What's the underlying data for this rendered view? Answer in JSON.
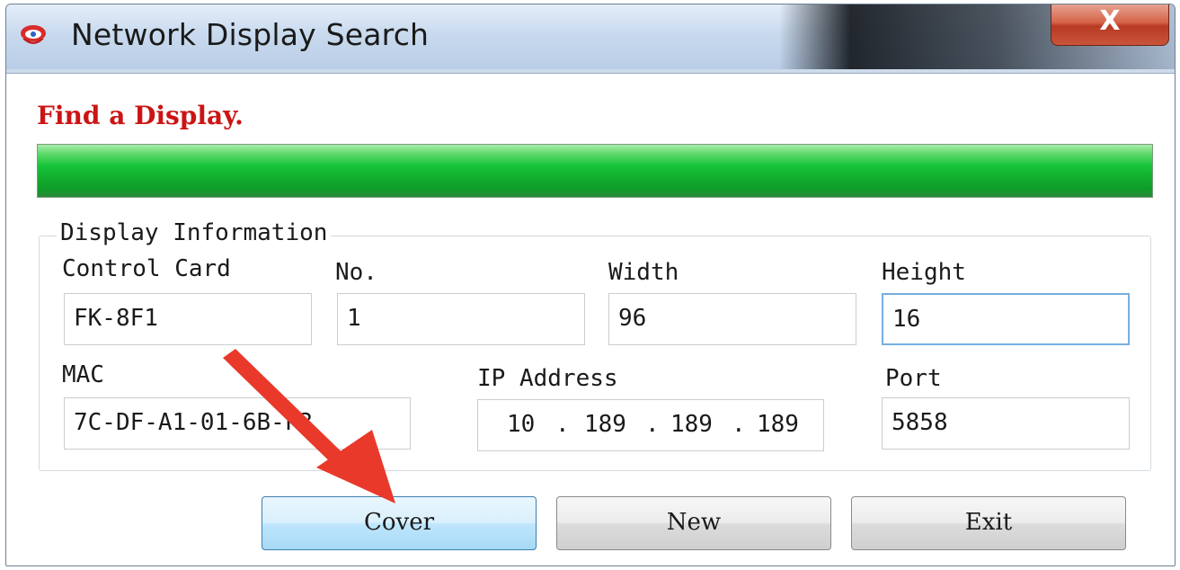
{
  "window": {
    "title": "Network Display Search",
    "close_label": "X"
  },
  "status": {
    "message": "Find a Display.",
    "progress": 1.0
  },
  "display_info": {
    "group_title": "Display Information",
    "control_card": {
      "label": "Control Card",
      "value": "FK-8F1"
    },
    "no": {
      "label": "No.",
      "value": "1"
    },
    "width": {
      "label": "Width",
      "value": "96"
    },
    "height": {
      "label": "Height",
      "value": "16"
    },
    "mac": {
      "label": "MAC",
      "value": "7C-DF-A1-01-6B-F3"
    },
    "ip": {
      "label": "IP Address",
      "octets": [
        "10",
        "189",
        "189",
        "189"
      ],
      "separator": "."
    },
    "port": {
      "label": "Port",
      "value": "5858"
    }
  },
  "buttons": {
    "cover": "Cover",
    "new": "New",
    "exit": "Exit"
  },
  "annotation": {
    "arrow_color": "#e8392b"
  }
}
